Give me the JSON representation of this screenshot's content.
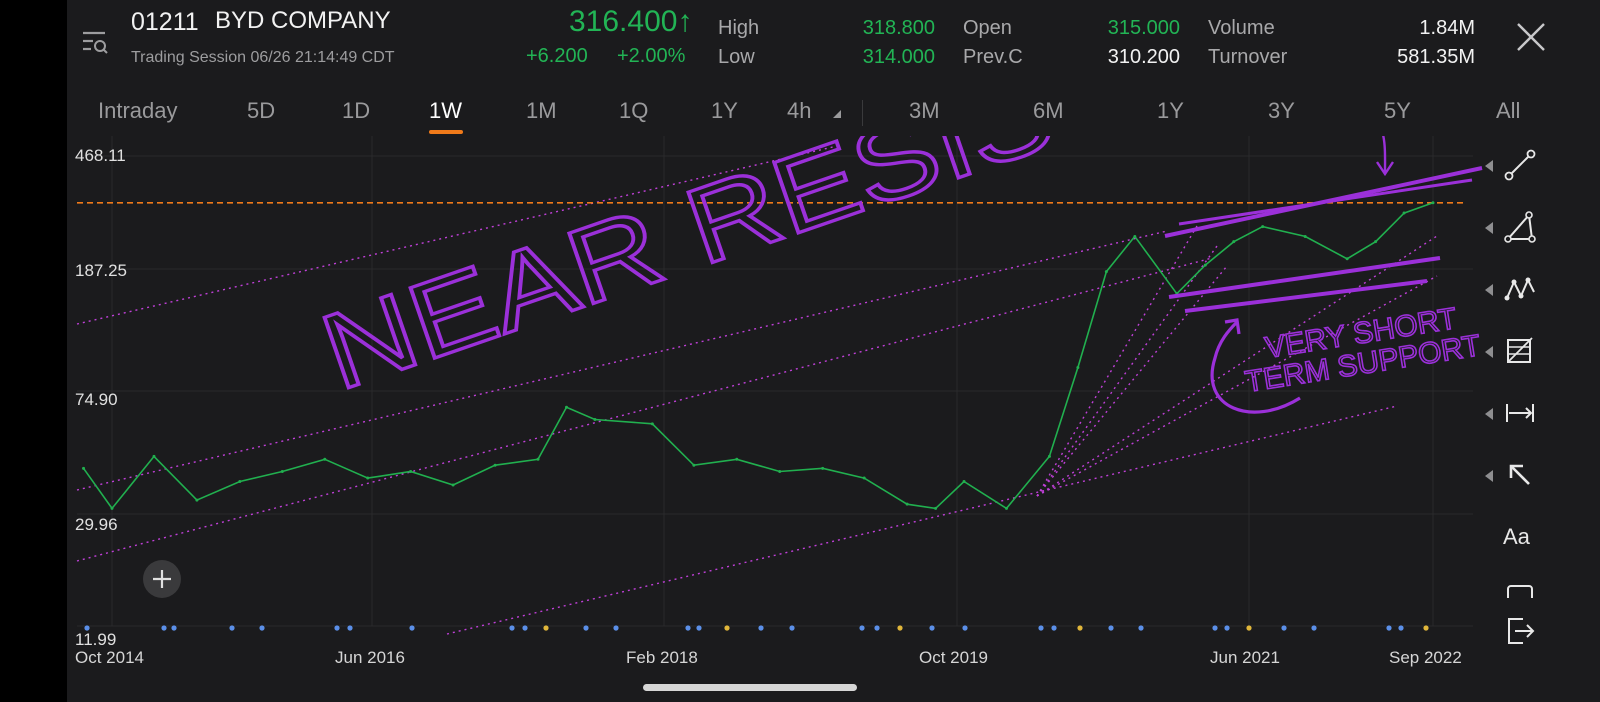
{
  "header": {
    "menu_icon": "menu-search-icon",
    "stock_code": "01211",
    "company_name": "BYD COMPANY",
    "session": "Trading Session  06/26 21:14:49 CDT",
    "price": "316.400",
    "price_arrow": "↑",
    "change": "+6.200",
    "change_pct": "+2.00%",
    "stats": {
      "high_label": "High",
      "high": "318.800",
      "low_label": "Low",
      "low": "314.000",
      "open_label": "Open",
      "open": "315.000",
      "prevc_label": "Prev.C",
      "prevc": "310.200",
      "volume_label": "Volume",
      "volume": "1.84M",
      "turnover_label": "Turnover",
      "turnover": "581.35M"
    },
    "close_icon": "close-icon"
  },
  "tabs": [
    "Intraday",
    "5D",
    "1D",
    "1W",
    "1M",
    "1Q",
    "1Y",
    "4h",
    "3M",
    "6M",
    "1Y",
    "3Y",
    "5Y",
    "All"
  ],
  "active_tab": "1W",
  "toolbar": {
    "tools": [
      "trend-line-icon",
      "triangle-tool-icon",
      "pattern-tool-icon",
      "fibonacci-tool-icon",
      "measure-tool-icon",
      "arrow-tool-icon",
      "text-tool-icon",
      "rectangle-tool-icon",
      "exit-icon"
    ],
    "text_tool_label": "Aa"
  },
  "plus_icon": "plus-icon",
  "colors": {
    "up": "#22b455",
    "line": "#21b04f",
    "accent": "#f07a1a",
    "annotation": "#9b30d9",
    "background": "#1b1b1d"
  },
  "annotations": {
    "resistance": "NEAR RESISTANCE",
    "support_line1": "VERY SHORT",
    "support_line2": "TERM SUPPORT"
  },
  "chart_data": {
    "type": "line",
    "yscale": "log",
    "ylim": [
      11.99,
      468.11
    ],
    "y_ticks": [
      "468.11",
      "187.25",
      "74.90",
      "29.96",
      "11.99"
    ],
    "x_ticks": [
      "Oct 2014",
      "Jun 2016",
      "Feb 2018",
      "Oct 2019",
      "Jun 2021",
      "Sep 2022"
    ],
    "resistance_level": 325,
    "grid": true,
    "series": [
      {
        "x": [
          "2014-10",
          "2014-12",
          "2015-03",
          "2015-06",
          "2015-09",
          "2015-12",
          "2016-03",
          "2016-06",
          "2016-09",
          "2016-12",
          "2017-03",
          "2017-06",
          "2017-08",
          "2017-10",
          "2018-02",
          "2018-05",
          "2018-08",
          "2018-11",
          "2019-02",
          "2019-05",
          "2019-08",
          "2019-10",
          "2019-12",
          "2020-03",
          "2020-06",
          "2020-08",
          "2020-10",
          "2020-12",
          "2021-03",
          "2021-05",
          "2021-07",
          "2021-09",
          "2021-12",
          "2022-03",
          "2022-05",
          "2022-07",
          "2022-09"
        ],
        "values": [
          41,
          30,
          45,
          32,
          37,
          40,
          44,
          38,
          40,
          36,
          42,
          44,
          66,
          60,
          58,
          42,
          44,
          40,
          41,
          38,
          31,
          30,
          37,
          30,
          45,
          90,
          190,
          250,
          160,
          200,
          240,
          270,
          250,
          210,
          240,
          300,
          325
        ]
      }
    ]
  }
}
